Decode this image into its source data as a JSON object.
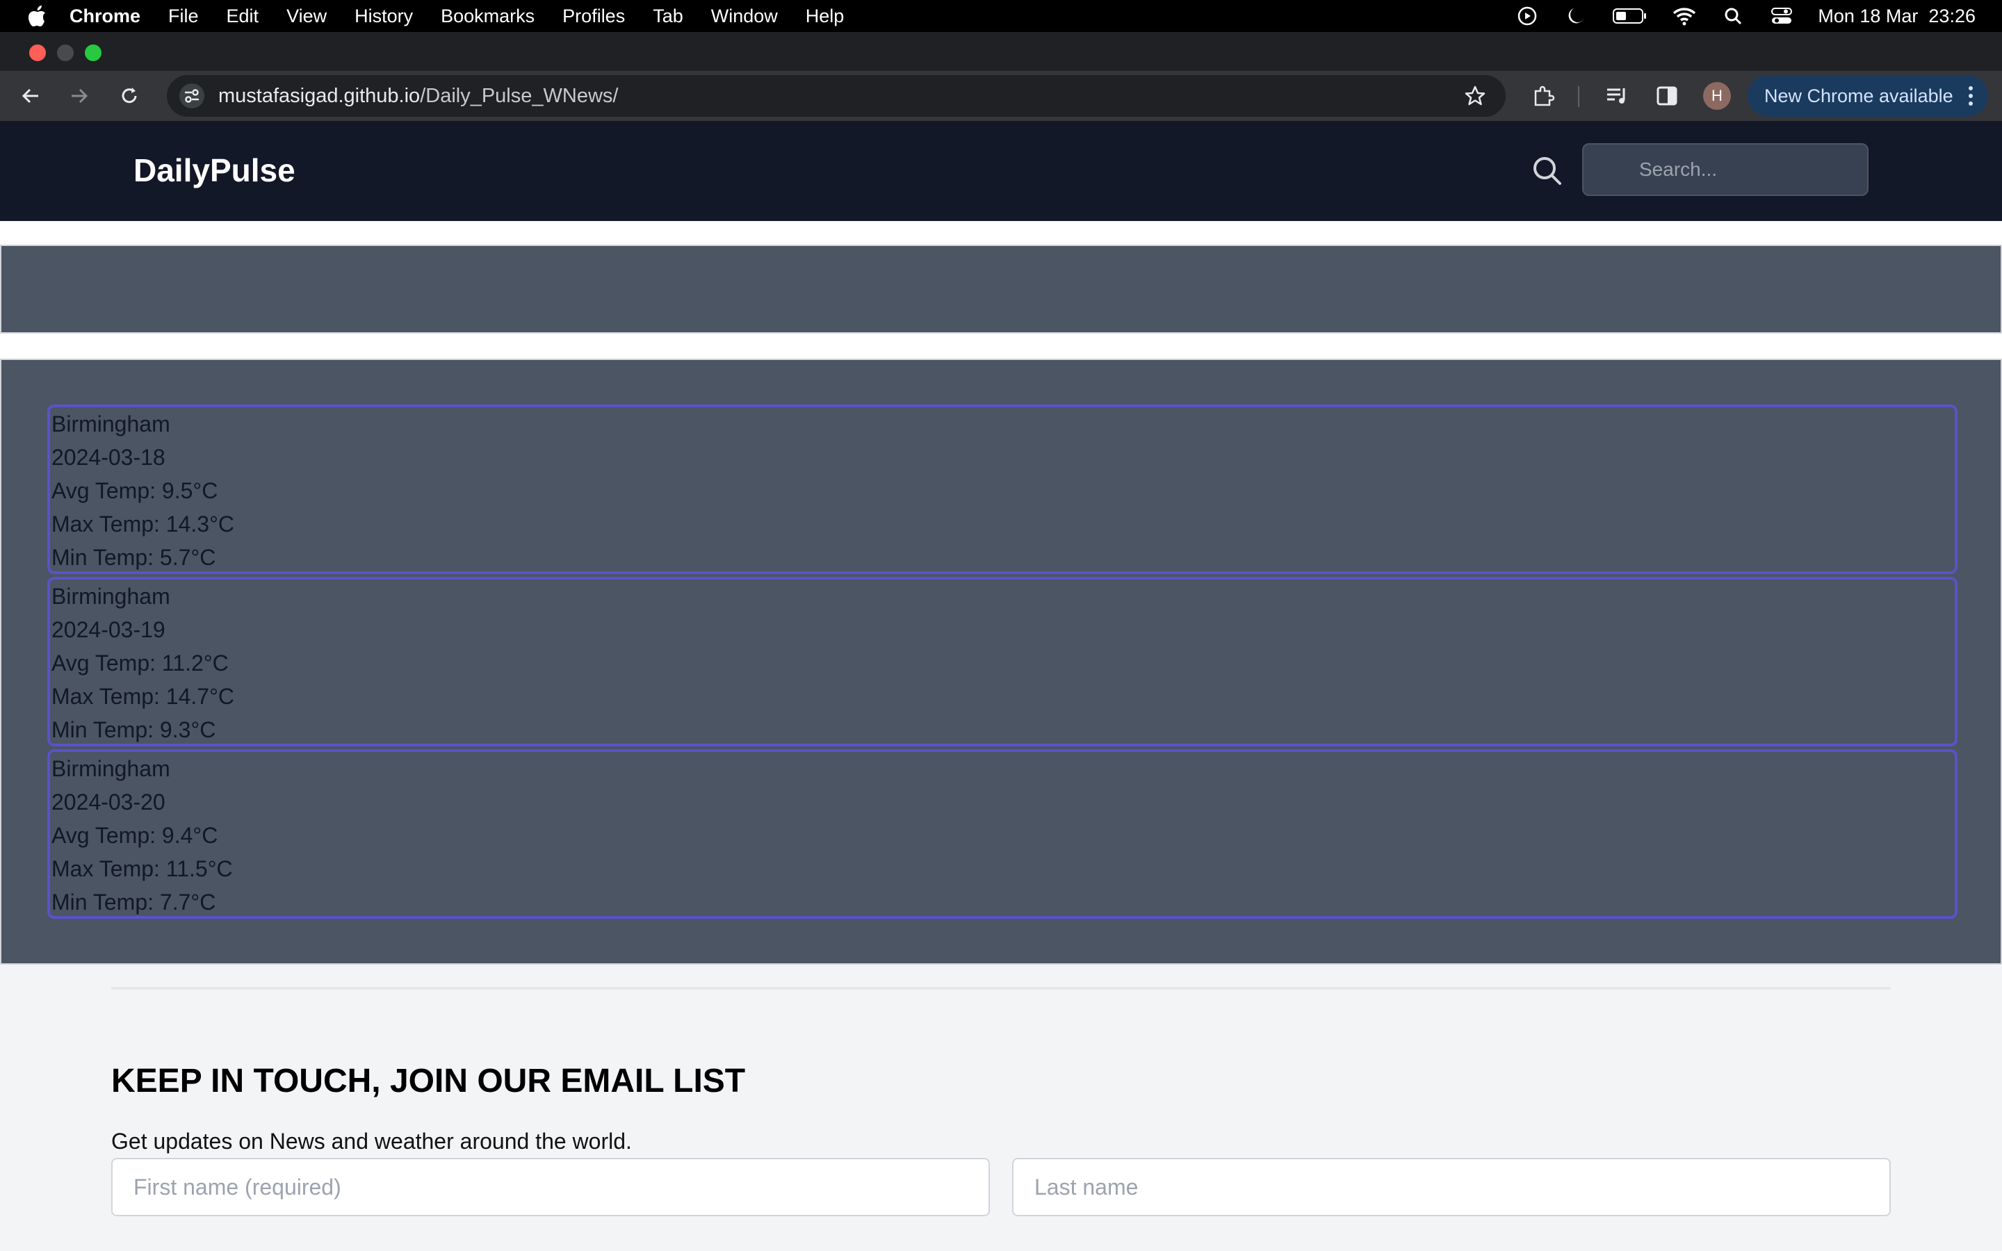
{
  "menubar": {
    "app": "Chrome",
    "items": [
      "File",
      "Edit",
      "View",
      "History",
      "Bookmarks",
      "Profiles",
      "Tab",
      "Window",
      "Help"
    ],
    "clock": "Mon 18 Mar  23:26"
  },
  "browser": {
    "url_host": "mustafasigad.github.io",
    "url_path": "/Daily_Pulse_WNews/",
    "profile_initial": "H",
    "update_label": "New Chrome available"
  },
  "header": {
    "brand": "DailyPulse",
    "search_placeholder": "Search..."
  },
  "forecast": [
    {
      "city": "Birmingham",
      "date": "2024-03-18",
      "avg": "Avg Temp: 9.5°C",
      "max": "Max Temp: 14.3°C",
      "min": "Min Temp: 5.7°C"
    },
    {
      "city": "Birmingham",
      "date": "2024-03-19",
      "avg": "Avg Temp: 11.2°C",
      "max": "Max Temp: 14.7°C",
      "min": "Min Temp: 9.3°C"
    },
    {
      "city": "Birmingham",
      "date": "2024-03-20",
      "avg": "Avg Temp: 9.4°C",
      "max": "Max Temp: 11.5°C",
      "min": "Min Temp: 7.7°C"
    }
  ],
  "newsletter": {
    "title": "KEEP IN TOUCH, JOIN OUR EMAIL LIST",
    "subtitle": "Get updates on News and weather around the world.",
    "first_name_placeholder": "First name (required)",
    "last_name_placeholder": "Last name"
  },
  "colors": {
    "header_bg": "#121827",
    "panel_bg": "#4b5563",
    "card_border": "#5853c8",
    "footer_bg": "#f3f4f6"
  }
}
